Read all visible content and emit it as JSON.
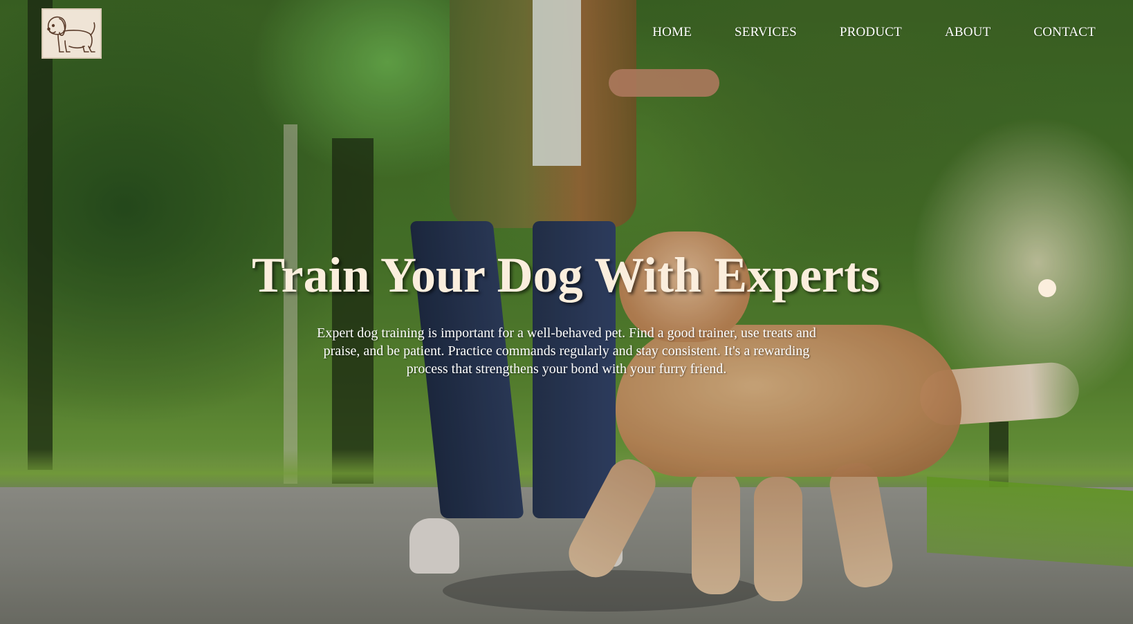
{
  "header": {
    "logo_icon": "dog-logo-icon",
    "nav": [
      {
        "label": "HOME"
      },
      {
        "label": "SERVICES"
      },
      {
        "label": "PRODUCT"
      },
      {
        "label": "ABOUT"
      },
      {
        "label": "CONTACT"
      }
    ]
  },
  "hero": {
    "title": "Train Your Dog With Experts",
    "description": "Expert dog training is important for a well-behaved pet. Find a good trainer, use treats and praise, and be patient. Practice commands regularly and stay consistent. It's a rewarding process that strengthens your bond with your furry friend.",
    "background_icon": "dog-training-photo",
    "slider_dot_icon": "slider-dot-icon"
  },
  "colors": {
    "title": "#fbeedd",
    "nav_text": "#ffffff",
    "logo_bg": "#efe4d6",
    "dot": "#fbeedd"
  }
}
